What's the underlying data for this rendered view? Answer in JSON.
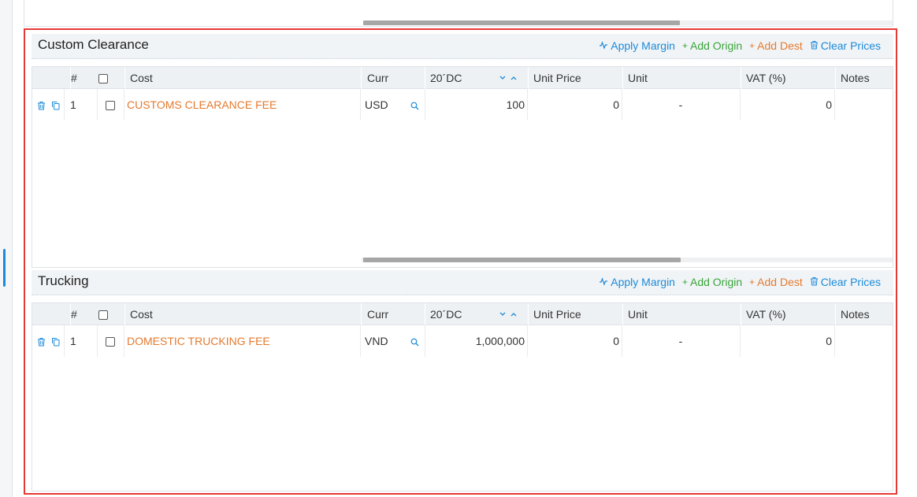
{
  "sections": [
    {
      "title": "Custom Clearance",
      "actions": {
        "apply_margin": "Apply Margin",
        "add_origin": "Add Origin",
        "add_dest": "Add Dest",
        "clear_prices": "Clear Prices"
      },
      "columns": {
        "index": "#",
        "cost": "Cost",
        "curr": "Curr",
        "container": "20´DC",
        "unit_price": "Unit Price",
        "unit": "Unit",
        "vat": "VAT (%)",
        "notes": "Notes"
      },
      "rows": [
        {
          "index": "1",
          "cost": "CUSTOMS CLEARANCE FEE",
          "curr": "USD",
          "container": "100",
          "unit_price": "0",
          "unit": "-",
          "vat": "0",
          "notes": ""
        }
      ]
    },
    {
      "title": "Trucking",
      "actions": {
        "apply_margin": "Apply Margin",
        "add_origin": "Add Origin",
        "add_dest": "Add Dest",
        "clear_prices": "Clear Prices"
      },
      "columns": {
        "index": "#",
        "cost": "Cost",
        "curr": "Curr",
        "container": "20´DC",
        "unit_price": "Unit Price",
        "unit": "Unit",
        "vat": "VAT (%)",
        "notes": "Notes"
      },
      "rows": [
        {
          "index": "1",
          "cost": "DOMESTIC TRUCKING FEE",
          "curr": "VND",
          "container": "1,000,000",
          "unit_price": "0",
          "unit": "-",
          "vat": "0",
          "notes": ""
        }
      ]
    }
  ],
  "icons": {
    "apply_margin": "activity-icon",
    "add": "plus-icon",
    "clear": "trash-icon",
    "row_delete": "trash-icon",
    "row_copy": "copy-icon",
    "curr_search": "search-icon",
    "sort_desc": "chevron-down-icon",
    "sort_asc": "chevron-up-icon"
  },
  "colors": {
    "accent_blue": "#1c8ad8",
    "accent_green": "#3aa43a",
    "accent_orange": "#e47a2e",
    "highlight_red": "#e53935"
  }
}
